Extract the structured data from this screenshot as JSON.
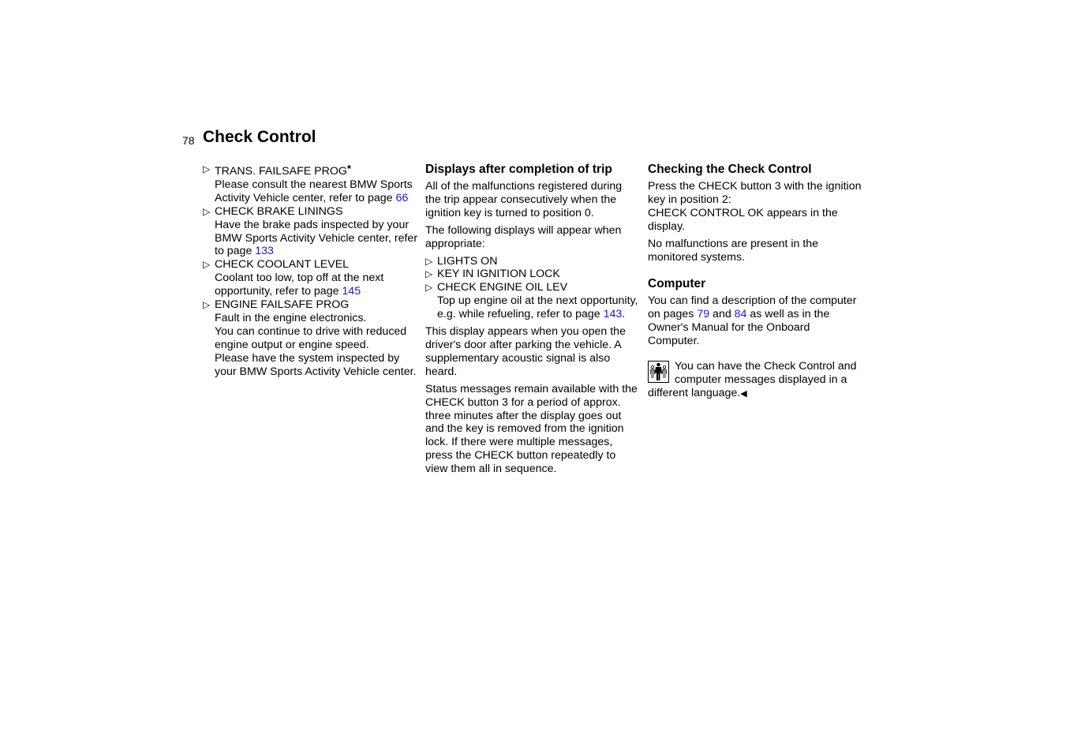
{
  "header": {
    "page_number": "78",
    "title": "Check Control"
  },
  "column1": {
    "items": [
      {
        "label": "TRANS. FAILSAFE PROG",
        "star": "*",
        "text": "Please consult the nearest BMW Sports Activity Vehicle center, refer to page ",
        "link": "66",
        "after": ""
      },
      {
        "label": "CHECK BRAKE LININGS",
        "text": "Have the brake pads inspected by your BMW Sports Activity Vehicle center, refer to page ",
        "link": "133",
        "after": ""
      },
      {
        "label": "CHECK COOLANT LEVEL",
        "text": "Coolant too low, top off at the next opportunity, refer to page ",
        "link": "145",
        "after": ""
      },
      {
        "label": "ENGINE FAILSAFE PROG",
        "text1": "Fault in the engine electronics.",
        "text2": "You can continue to drive with reduced engine output or engine speed.",
        "text3": "Please have the system inspected by your BMW Sports Activity Vehicle center."
      }
    ]
  },
  "column2": {
    "heading": "Displays after completion of trip",
    "p1": "All of the malfunctions registered during the trip appear consecutively when the ignition key is turned to position 0.",
    "p2": "The following displays will appear when appropriate:",
    "items": [
      {
        "label": "LIGHTS ON"
      },
      {
        "label": "KEY IN IGNITION LOCK"
      },
      {
        "label": "CHECK ENGINE OIL LEV",
        "text": "Top up engine oil at the next opportunity, e.g. while refueling, refer to page ",
        "link": "143",
        "after": "."
      }
    ],
    "p3": "This display appears when you open the driver's door after parking the vehicle. A supplementary acoustic signal is also heard.",
    "p4": "Status messages remain available with the CHECK button 3 for a period of approx. three minutes after the display goes out and the key is removed from the ignition lock. If there were multiple messages, press the CHECK button repeatedly to view them all in sequence."
  },
  "column3": {
    "heading1": "Checking the Check Control",
    "p1a": "Press the CHECK button 3 with the ignition key in position 2:",
    "p1b": "CHECK CONTROL OK appears in the display.",
    "p2": "No malfunctions are present in the monitored systems.",
    "heading2": "Computer",
    "p3_pre": "You can find a description of the computer on pages ",
    "p3_link1": "79",
    "p3_mid": " and ",
    "p3_link2": "84",
    "p3_post": " as well as in the Owner's Manual for the Onboard Computer.",
    "note": "You can have the Check Control and computer messages displayed in a different language.",
    "end_mark": "◀"
  },
  "icons": {
    "bullet": "▷",
    "note_icon": "people-language-icon"
  },
  "colors": {
    "link": "#1a1adc",
    "text": "#000000"
  }
}
